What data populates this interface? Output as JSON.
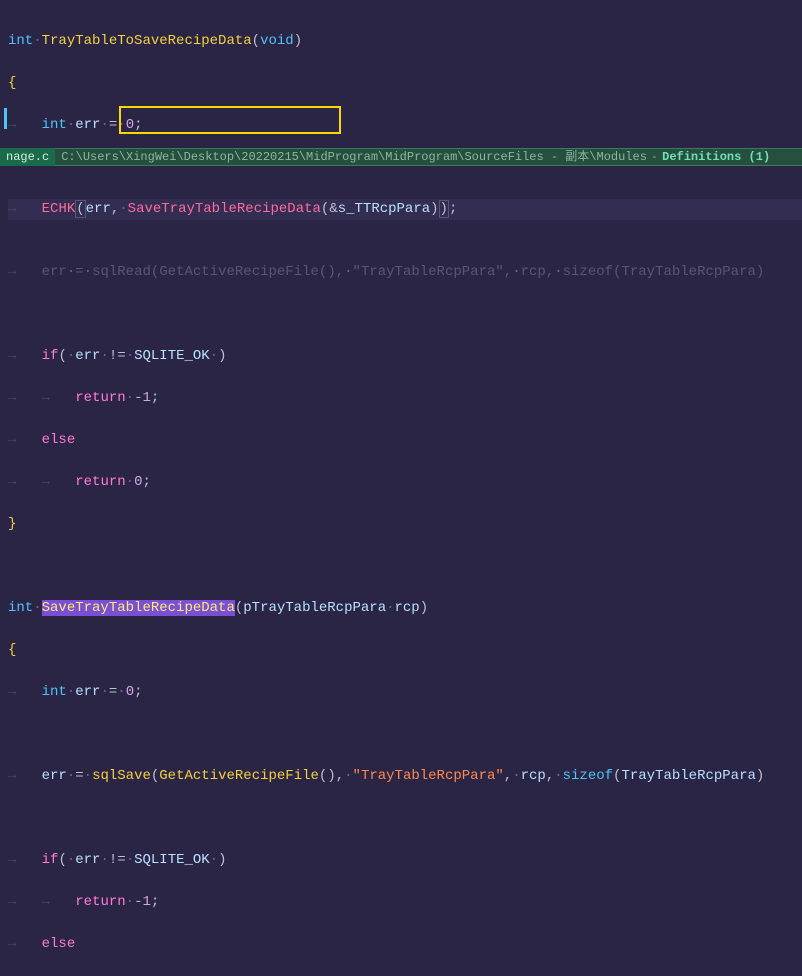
{
  "code": {
    "l1_kw": "int",
    "l1_fn": "TrayTableToSaveRecipeData",
    "l1_void": "void",
    "l3_kw": "int",
    "l3_var": "err",
    "l3_num": "0",
    "l5_echk": "ECHK",
    "l5_err": "err",
    "l5_fn": "SaveTrayTableRecipeData",
    "l5_arg": "s_TTRcpPara",
    "l7_err": "err",
    "l7_fn1": "sqlRead",
    "l7_fn2": "GetActiveRecipeFile",
    "l7_str": "\"TrayTableRcpPara\"",
    "l7_rcp": "rcp",
    "l7_sizeof": "sizeof",
    "l7_type": "TrayTableRcpPara",
    "l9_if": "if",
    "l9_err": "err",
    "l9_neq": "!=",
    "l9_const": "SQLITE_OK",
    "l10_ret": "return",
    "l10_val": "-1",
    "l11_else": "else",
    "l12_ret": "return",
    "l12_val": "0",
    "l15_kw": "int",
    "l15_fn": "SaveTrayTableRecipeData",
    "l15_ptype": "pTrayTableRcpPara",
    "l15_pname": "rcp",
    "l17_kw": "int",
    "l17_var": "err",
    "l17_num": "0",
    "l19_err": "err",
    "l19_fn1": "sqlSave",
    "l19_fn2": "GetActiveRecipeFile",
    "l19_str": "\"TrayTableRcpPara\"",
    "l19_rcp": "rcp",
    "l19_sizeof": "sizeof",
    "l19_type": "TrayTableRcpPara",
    "l21_if": "if",
    "l21_err": "err",
    "l21_neq": "!=",
    "l21_const": "SQLITE_OK",
    "l22_ret": "return",
    "l22_val": "-1",
    "l23_else": "else"
  },
  "peek": {
    "tab": "nage.c",
    "path": "C:\\Users\\XingWei\\Desktop\\20220215\\MidProgram\\MidProgram\\SourceFiles - 副本\\Modules",
    "defs": "Definitions (1)"
  },
  "ws": {
    "arrow": "→",
    "dot": "·"
  }
}
